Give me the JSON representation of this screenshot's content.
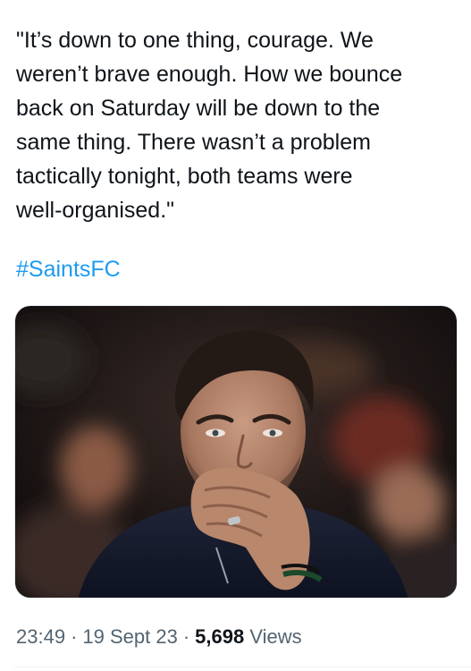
{
  "tweet": {
    "text": "\"It’s down to one thing, courage. We\nweren’t brave enough. How we bounce\nback on Saturday will be down to the\nsame thing. There wasn’t a problem\ntactically tonight, both teams were\nwell-organised.\"",
    "hashtag": "#SaintsFC",
    "photo_alt": "man in dark jacket covering mouth with hand"
  },
  "meta": {
    "time": "23:49",
    "separator": "·",
    "date": "19 Sept 23",
    "views_count": "5,698",
    "views_label": "Views"
  },
  "colors": {
    "text": "#0f1419",
    "link": "#1d9bf0",
    "secondary": "#536471"
  }
}
